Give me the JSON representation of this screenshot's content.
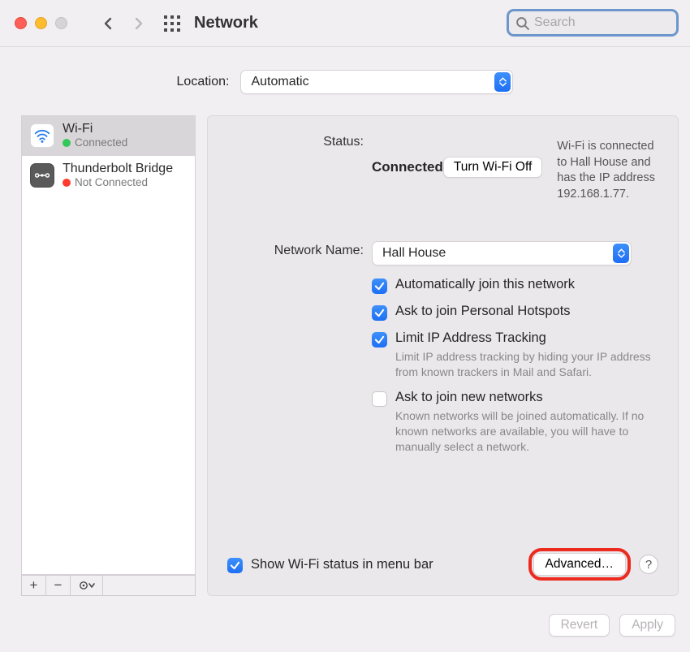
{
  "toolbar": {
    "title": "Network",
    "search_placeholder": "Search"
  },
  "location": {
    "label": "Location:",
    "value": "Automatic"
  },
  "services": [
    {
      "name": "Wi-Fi",
      "status": "Connected",
      "status_color": "green",
      "selected": true,
      "kind": "wifi"
    },
    {
      "name": "Thunderbolt Bridge",
      "status": "Not Connected",
      "status_color": "red",
      "selected": false,
      "kind": "tb"
    }
  ],
  "detail": {
    "status_label": "Status:",
    "status_value": "Connected",
    "toggle_button": "Turn Wi-Fi Off",
    "status_description": "Wi-Fi is connected to Hall House and has the IP address 192.168.1.77.",
    "network_name_label": "Network Name:",
    "network_name_value": "Hall House",
    "checks": {
      "auto_join": {
        "label": "Automatically join this network",
        "checked": true
      },
      "hotspots": {
        "label": "Ask to join Personal Hotspots",
        "checked": true
      },
      "limit_ip": {
        "label": "Limit IP Address Tracking",
        "checked": true,
        "sub": "Limit IP address tracking by hiding your IP address from known trackers in Mail and Safari."
      },
      "ask_new": {
        "label": "Ask to join new networks",
        "checked": false,
        "sub": "Known networks will be joined automatically. If no known networks are available, you will have to manually select a network."
      }
    },
    "menubar_label": "Show Wi-Fi status in menu bar",
    "menubar_checked": true,
    "advanced_button": "Advanced…",
    "help_label": "?"
  },
  "footer": {
    "revert": "Revert",
    "apply": "Apply"
  }
}
